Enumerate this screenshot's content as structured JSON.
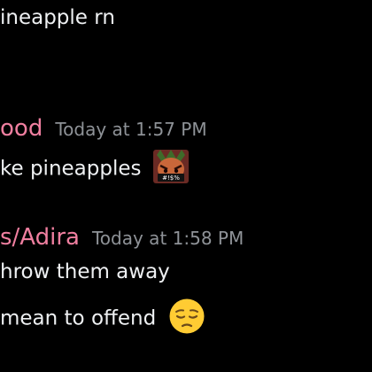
{
  "colors": {
    "background": "#000000",
    "text": "#eef0f2",
    "timestamp": "#8e9297",
    "author_pink": "#f07fa0"
  },
  "messages": [
    {
      "lines": [
        {
          "text": "ineapple rn"
        }
      ]
    },
    {
      "author": "ood",
      "timestamp": "Today at 1:57 PM",
      "lines": [
        {
          "text": "ke pineapples",
          "sticker": {
            "name": "angry-pineapple-sticker",
            "caption": "#!$%"
          }
        }
      ]
    },
    {
      "author": "s/Adira",
      "timestamp": "Today at 1:58 PM",
      "lines": [
        {
          "text": "hrow them away"
        },
        {
          "text": "mean to offend",
          "emoji": "pensive-face-emoji"
        }
      ]
    }
  ]
}
